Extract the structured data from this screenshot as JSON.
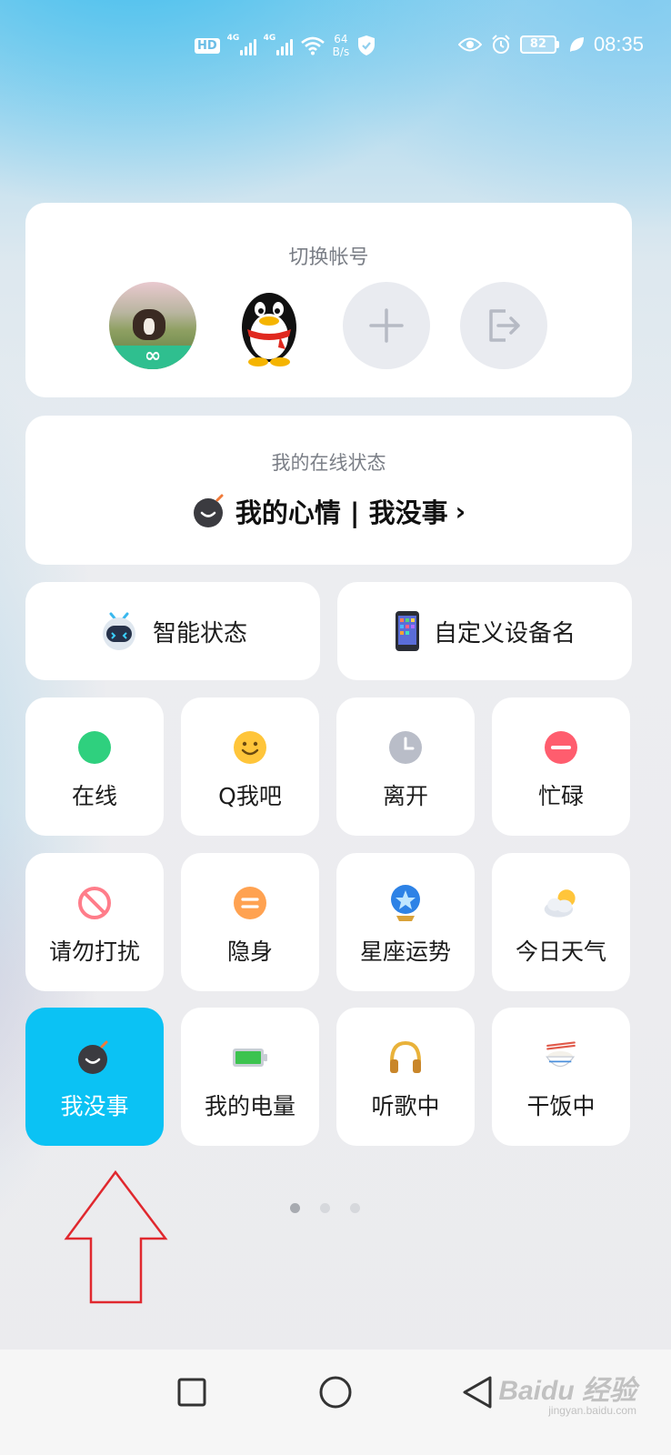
{
  "status_bar": {
    "hd_label": "HD",
    "network1": "4G",
    "network2": "4G",
    "speed_value": "64",
    "speed_unit": "B/s",
    "battery": "82",
    "time": "08:35"
  },
  "account_card": {
    "title": "切换帐号",
    "avatar_badge": "∞"
  },
  "online_card": {
    "title": "我的在线状态",
    "mood_label": "我的心情 | 我没事",
    "chevron": "›"
  },
  "quick_actions": {
    "smart_status": "智能状态",
    "device_name": "自定义设备名"
  },
  "status_tiles": [
    {
      "label": "在线",
      "icon": "online-dot-icon",
      "color": "#2fd07e"
    },
    {
      "label": "Q我吧",
      "icon": "smile-icon",
      "color": "#ffc53a"
    },
    {
      "label": "离开",
      "icon": "clock-icon",
      "color": "#b9bdc8"
    },
    {
      "label": "忙碌",
      "icon": "minus-circle-icon",
      "color": "#ff5d6e"
    },
    {
      "label": "请勿打扰",
      "icon": "no-disturb-icon",
      "color": "#ff7d8a"
    },
    {
      "label": "隐身",
      "icon": "invisible-icon",
      "color": "#ffa251"
    },
    {
      "label": "星座运势",
      "icon": "crystal-ball-icon",
      "color": "#2d82e6"
    },
    {
      "label": "今日天气",
      "icon": "weather-icon",
      "color": "#ffc53a"
    },
    {
      "label": "我没事",
      "icon": "smiley-bomb-icon",
      "color": "#0bc2f4",
      "active": true
    },
    {
      "label": "我的电量",
      "icon": "battery-icon",
      "color": "#3cc34f"
    },
    {
      "label": "听歌中",
      "icon": "headphones-icon",
      "color": "#e9b23a"
    },
    {
      "label": "干饭中",
      "icon": "rice-bowl-icon",
      "color": "#e05a4a"
    }
  ],
  "pager": {
    "pages": 3,
    "current": 1
  },
  "watermark": {
    "main": "Baidu 经验",
    "sub": "jingyan.baidu.com"
  }
}
